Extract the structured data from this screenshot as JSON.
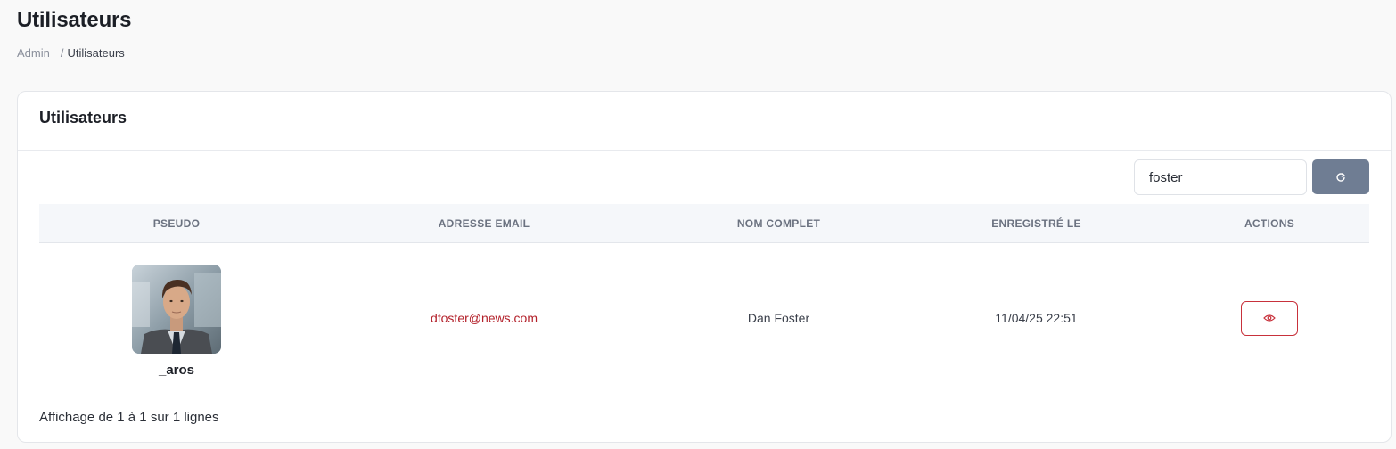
{
  "page": {
    "title": "Utilisateurs",
    "breadcrumb": {
      "root": "Admin",
      "separator": "/",
      "current": "Utilisateurs"
    }
  },
  "card": {
    "title": "Utilisateurs",
    "search": {
      "value": "foster",
      "placeholder": ""
    },
    "refresh_icon": "refresh-icon",
    "table": {
      "headers": [
        "PSEUDO",
        "ADRESSE EMAIL",
        "NOM COMPLET",
        "ENREGISTRÉ LE",
        "ACTIONS"
      ],
      "rows": [
        {
          "pseudo": "_aros",
          "avatar": "avatar-photo",
          "email": "dfoster@news.com",
          "full_name": "Dan Foster",
          "registered": "11/04/25 22:51",
          "action_icon": "eye-icon"
        }
      ]
    },
    "footer": "Affichage de 1 à 1 sur 1 lignes"
  },
  "colors": {
    "accent_red": "#b3202a",
    "button_gray": "#6f7d93",
    "header_bg": "#f5f7fa"
  }
}
